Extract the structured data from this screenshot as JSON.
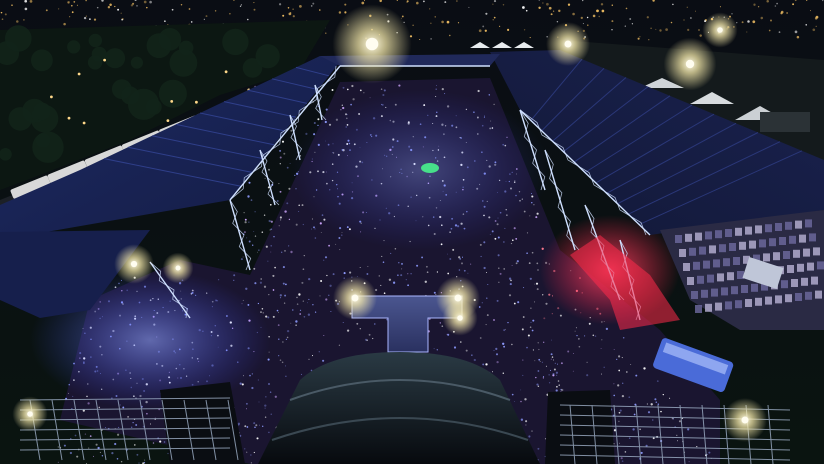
{
  "image": {
    "kind": "photograph",
    "subject": "aerial-night-concert",
    "colors": {
      "sky": "#060a12",
      "city_lights": "#e8b860",
      "trees": "#0d1a14",
      "roof": "#1b2456",
      "roof_edge": "#2f3f8a",
      "truss": "#cfe0ff",
      "crowd_base": "#1a1530",
      "crowd_glow_blue": "#6f7dff",
      "crowd_glow_white": "#ffffff",
      "crowd_glow_pink": "#ff5a78",
      "pink_light": "#ff2a4a",
      "floodlight": "#fff6d0",
      "stage_canopy": "#121a22",
      "catwalk": "#3a4470",
      "bus_white": "#d8d8d8",
      "van_blue": "#4a6bd8"
    }
  }
}
